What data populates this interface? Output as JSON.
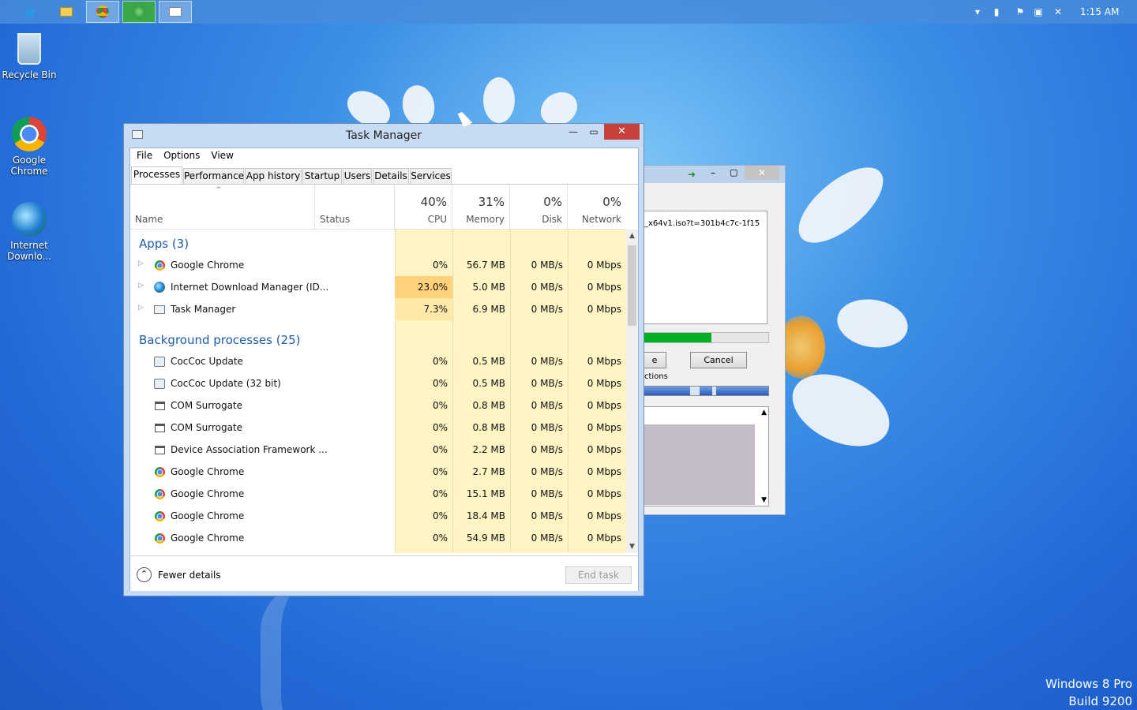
{
  "taskbar": {
    "pinned": [
      {
        "name": "ie-icon",
        "glyph": "e",
        "color": "#1fa0e6"
      },
      {
        "name": "file-explorer-icon",
        "glyph": "▭",
        "color": "#f4cf58"
      },
      {
        "name": "chrome-icon",
        "glyph": "◉",
        "color": "#dd3b2a"
      },
      {
        "name": "idm-icon",
        "glyph": "●",
        "color": "#2aa33a"
      },
      {
        "name": "task-manager-icon",
        "glyph": "▤",
        "color": "#ffffff"
      }
    ],
    "clock": "1:15 AM"
  },
  "desktop": {
    "icons": [
      {
        "label": "Recycle Bin"
      },
      {
        "label": "Google Chrome"
      },
      {
        "label": "Internet Downlo..."
      }
    ]
  },
  "idm_window": {
    "url_fragment": "_x64v1.iso?t=301b4c7c-1f15",
    "download_progress_fraction": 0.54,
    "left_button_fragment": "e",
    "cancel_label": "Cancel",
    "connections_fragment": "ctions"
  },
  "task_manager": {
    "title": "Task Manager",
    "menu": [
      "File",
      "Options",
      "View"
    ],
    "tabs": [
      "Processes",
      "Performance",
      "App history",
      "Startup",
      "Users",
      "Details",
      "Services"
    ],
    "selected_tab": "Processes",
    "columns": {
      "name": "Name",
      "status": "Status",
      "cpu": {
        "pct": "40%",
        "label": "CPU"
      },
      "memory": {
        "pct": "31%",
        "label": "Memory"
      },
      "disk": {
        "pct": "0%",
        "label": "Disk"
      },
      "network": {
        "pct": "0%",
        "label": "Network"
      }
    },
    "apps_header": "Apps (3)",
    "apps": [
      {
        "name": "Google Chrome",
        "icon": "chrome-icon",
        "cpu": "0%",
        "memory": "56.7 MB",
        "disk": "0 MB/s",
        "network": "0 Mbps"
      },
      {
        "name": "Internet Download Manager (ID...",
        "icon": "idm-icon",
        "cpu": "23.0%",
        "memory": "5.0 MB",
        "disk": "0 MB/s",
        "network": "0 Mbps"
      },
      {
        "name": "Task Manager",
        "icon": "task-manager-icon",
        "cpu": "7.3%",
        "memory": "6.9 MB",
        "disk": "0 MB/s",
        "network": "0 Mbps"
      }
    ],
    "bg_header": "Background processes (25)",
    "background": [
      {
        "name": "CocCoc Update",
        "icon": "updater-icon",
        "cpu": "0%",
        "memory": "0.5 MB",
        "disk": "0 MB/s",
        "network": "0 Mbps"
      },
      {
        "name": "CocCoc Update (32 bit)",
        "icon": "updater-icon",
        "cpu": "0%",
        "memory": "0.5 MB",
        "disk": "0 MB/s",
        "network": "0 Mbps"
      },
      {
        "name": "COM Surrogate",
        "icon": "window-icon",
        "cpu": "0%",
        "memory": "0.8 MB",
        "disk": "0 MB/s",
        "network": "0 Mbps"
      },
      {
        "name": "COM Surrogate",
        "icon": "window-icon",
        "cpu": "0%",
        "memory": "0.8 MB",
        "disk": "0 MB/s",
        "network": "0 Mbps"
      },
      {
        "name": "Device Association Framework ...",
        "icon": "window-icon",
        "cpu": "0%",
        "memory": "2.2 MB",
        "disk": "0 MB/s",
        "network": "0 Mbps"
      },
      {
        "name": "Google Chrome",
        "icon": "chrome-icon",
        "cpu": "0%",
        "memory": "2.7 MB",
        "disk": "0 MB/s",
        "network": "0 Mbps"
      },
      {
        "name": "Google Chrome",
        "icon": "chrome-icon",
        "cpu": "0%",
        "memory": "15.1 MB",
        "disk": "0 MB/s",
        "network": "0 Mbps"
      },
      {
        "name": "Google Chrome",
        "icon": "chrome-icon",
        "cpu": "0%",
        "memory": "18.4 MB",
        "disk": "0 MB/s",
        "network": "0 Mbps"
      },
      {
        "name": "Google Chrome",
        "icon": "chrome-icon",
        "cpu": "0%",
        "memory": "54.9 MB",
        "disk": "0 MB/s",
        "network": "0 Mbps"
      }
    ],
    "fewer_details": "Fewer details",
    "end_task": "End task"
  },
  "watermark": {
    "line1": "Windows 8 Pro",
    "line2": "Build 9200"
  },
  "colors": {
    "cpu_shade": "#fff4c4",
    "cpu_hot": "#ffd27a",
    "cpu_warm": "#ffe9a8",
    "group_header": "#1e5ca8"
  }
}
